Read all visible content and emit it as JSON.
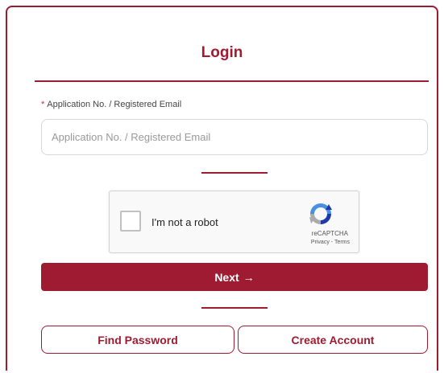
{
  "login": {
    "title": "Login",
    "field_label": "Application No. / Registered Email",
    "required_mark": "*",
    "input_placeholder": "Application No. / Registered Email",
    "input_value": ""
  },
  "captcha": {
    "checkbox_label": "I'm not a robot",
    "brand": "reCAPTCHA",
    "privacy": "Privacy",
    "separator": " - ",
    "terms": "Terms"
  },
  "actions": {
    "next_label": "Next",
    "next_arrow": "→",
    "find_password_label": "Find Password",
    "create_account_label": "Create Account"
  },
  "colors": {
    "accent": "#9e1b32",
    "required": "#d9223b"
  },
  "icons": {
    "next": "arrow-right-icon",
    "captcha": "recaptcha-logo-icon"
  }
}
